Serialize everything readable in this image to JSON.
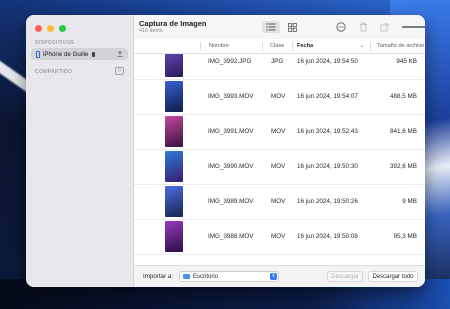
{
  "window": {
    "title": "Captura de Imagen",
    "subtitle": "416 ítems"
  },
  "sidebar": {
    "devices_heading": "DISPOSITIVOS",
    "device_name": "iPhone de Guille",
    "shared_heading": "COMPARTIDO"
  },
  "toolbar": {
    "zoom_level": 0.75,
    "icons": [
      "list-view-icon",
      "grid-view-icon",
      "more-options-icon",
      "delete-icon",
      "rotate-icon",
      "thumbnail-size-slider"
    ]
  },
  "table": {
    "columns": {
      "name": "Nombre",
      "type": "Clase",
      "date": "Fecha",
      "size": "Tamaño de archivo"
    },
    "rows": [
      {
        "name": "IMG_3992.JPG",
        "type": "JPG",
        "date": "16 jun 2024, 19:54:50",
        "size": "945 KB",
        "thumb": [
          "#6b4fc7",
          "#2a1a55"
        ]
      },
      {
        "name": "IMG_3993.MOV",
        "type": "MOV",
        "date": "16 jun 2024, 19:54:07",
        "size": "488,5 MB",
        "thumb": [
          "#3a5fd6",
          "#0d1c45"
        ]
      },
      {
        "name": "IMG_3991.MOV",
        "type": "MOV",
        "date": "16 jun 2024, 19:52:43",
        "size": "841,6 MB",
        "thumb": [
          "#c04a9e",
          "#3a1240"
        ]
      },
      {
        "name": "IMG_3990.MOV",
        "type": "MOV",
        "date": "16 jun 2024, 19:50:30",
        "size": "392,6 MB",
        "thumb": [
          "#2c7bd8",
          "#3a1d6e"
        ]
      },
      {
        "name": "IMG_3989.MOV",
        "type": "MOV",
        "date": "16 jun 2024, 19:50:26",
        "size": "9 MB",
        "thumb": [
          "#4a6ee0",
          "#1a2350"
        ]
      },
      {
        "name": "IMG_3988.MOV",
        "type": "MOV",
        "date": "16 jun 2024, 19:50:08",
        "size": "95,3 MB",
        "thumb": [
          "#9a3ac0",
          "#2a0f45"
        ]
      }
    ]
  },
  "footer": {
    "import_label": "Importar a:",
    "destination": "Escritorio",
    "download_label": "Descargar",
    "download_all_label": "Descargar todo"
  }
}
